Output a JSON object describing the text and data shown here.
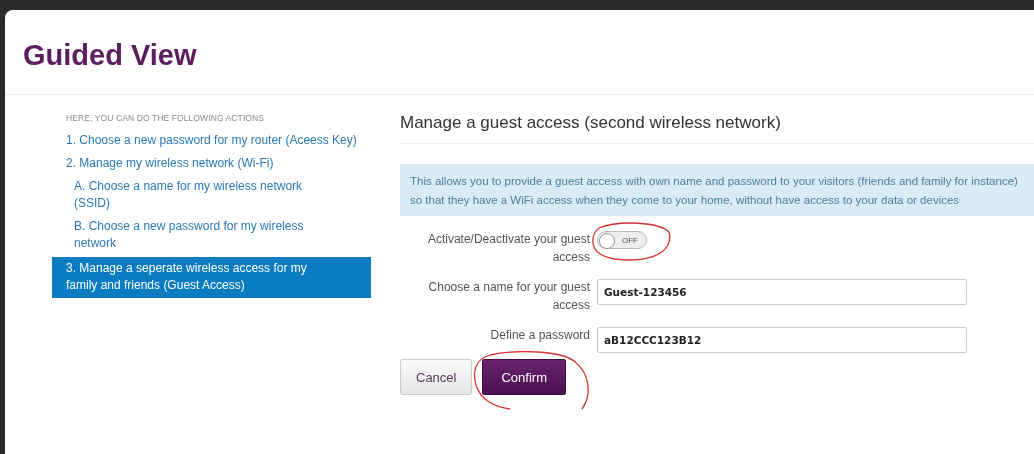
{
  "title": "Guided View",
  "sidebar": {
    "heading": "HERE, YOU CAN DO THE FOLLOWING ACTIONS",
    "items": [
      {
        "label": "1. Choose a new password for my router (Aceess Key)",
        "selected": false
      },
      {
        "label": "2. Manage my wireless network (Wi-Fi)",
        "selected": false,
        "children": [
          {
            "label": "A. Choose a name for my wireless network (SSID)",
            "selected": false
          },
          {
            "label": "B. Choose a new password for my wireless network",
            "selected": false
          }
        ]
      },
      {
        "label": "3. Manage a seperate wireless access for my family and friends (Guest Access)",
        "selected": true
      }
    ]
  },
  "section": {
    "title": "Manage a guest access (second wireless network)",
    "info": "This allows you to provide a guest access with own name and password to your visitors (friends and family for instance) so that they have a WiFi access when they come to your home, without have access to your data or devices"
  },
  "form": [
    {
      "kind": "toggle",
      "label": "Activate/Deactivate your guest access",
      "on": false,
      "text": "OFF",
      "highlighted": true
    },
    {
      "kind": "text",
      "label": "Choose a name for your guest access",
      "value": "Guest-123456"
    },
    {
      "kind": "text",
      "label": "Define a password",
      "value": "aB12CCC123B12"
    }
  ],
  "buttons": [
    {
      "label": "Cancel",
      "kind": "secondary",
      "highlighted": false
    },
    {
      "label": "Confirm",
      "kind": "primary",
      "highlighted": true
    }
  ]
}
